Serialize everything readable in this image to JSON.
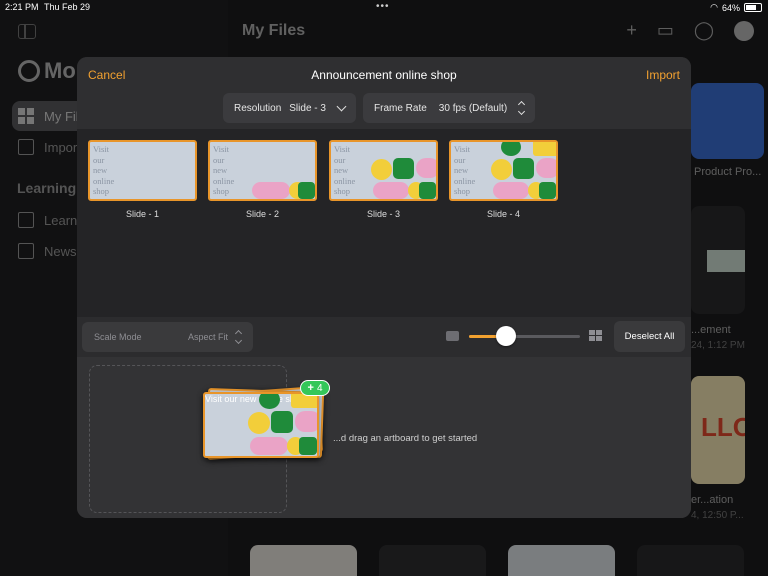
{
  "status_bar": {
    "time": "2:21 PM",
    "date": "Thu Feb 29",
    "battery": "64%"
  },
  "sidebar": {
    "brand": "Mo",
    "items": [
      {
        "label": "My Files"
      },
      {
        "label": "Import"
      }
    ],
    "section": "Learning C",
    "learning_items": [
      {
        "label": "Learn"
      },
      {
        "label": "News"
      }
    ]
  },
  "main": {
    "title": "My Files",
    "cards": [
      {
        "label": "Product Pro...",
        "sub": ""
      },
      {
        "label": "...ement",
        "sub": "24, 1:12 PM"
      },
      {
        "label": "er...ation",
        "sub": "4, 12:50 P..."
      }
    ]
  },
  "modal": {
    "cancel_label": "Cancel",
    "title": "Announcement online shop",
    "import_label": "Import",
    "resolution_label": "Resolution",
    "resolution_value": "Slide - 3",
    "framerate_label": "Frame Rate",
    "framerate_value": "30 fps (Default)",
    "slide_text": "Visit\nour\nnew\nonline\nshop",
    "slides": [
      {
        "label": "Slide - 1"
      },
      {
        "label": "Slide - 2"
      },
      {
        "label": "Slide - 3"
      },
      {
        "label": "Slide - 4"
      }
    ],
    "scale_mode_label": "Scale Mode",
    "scale_mode_value": "Aspect Fit",
    "zoom_level": 0.33,
    "deselect_label": "Deselect All",
    "drop_hint": "...d drag an artboard to get started",
    "selected_count": "4"
  },
  "colors": {
    "accent": "#f2a130",
    "slide_bg": "#c9d1db",
    "shape_yellow": "#f2ce3a",
    "shape_green": "#1f8b3a",
    "shape_pink": "#eaa3c6",
    "badge_green": "#34c759"
  }
}
